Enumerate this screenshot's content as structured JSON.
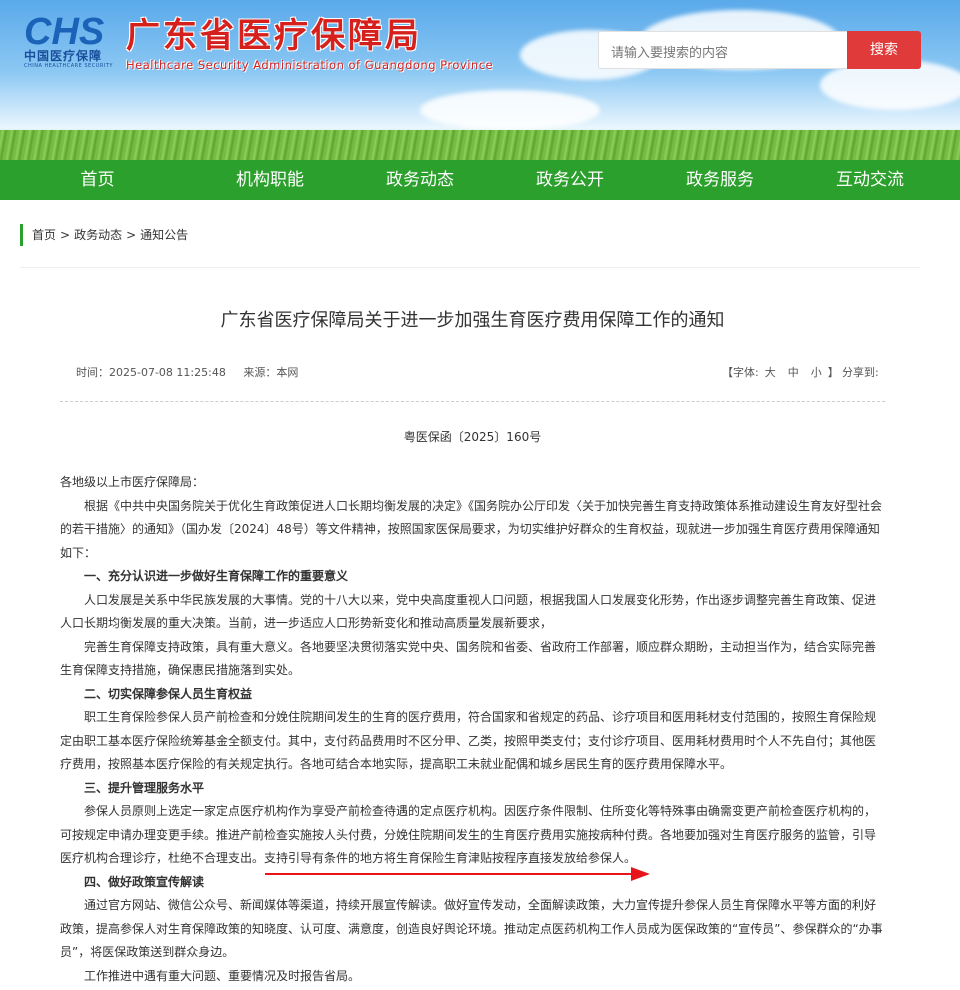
{
  "header": {
    "logo_mark": "CHS",
    "logo_cn": "中国医疗保障",
    "logo_en": "CHINA HEALTHCARE SECURITY",
    "title": "广东省医疗保障局",
    "subtitle": "Healthcare Security Administration of Guangdong Province",
    "search_placeholder": "请输入要搜索的内容",
    "search_button": "搜索"
  },
  "nav": {
    "items": [
      {
        "label": "首页"
      },
      {
        "label": "机构职能"
      },
      {
        "label": "政务动态"
      },
      {
        "label": "政务公开"
      },
      {
        "label": "政务服务"
      },
      {
        "label": "互动交流"
      }
    ]
  },
  "breadcrumb": {
    "items": [
      "首页",
      "政务动态",
      "通知公告"
    ],
    "separator": ">"
  },
  "article": {
    "title": "广东省医疗保障局关于进一步加强生育医疗费用保障工作的通知",
    "time": "时间：2025-07-08 11:25:48",
    "source": "来源：本网",
    "font_label_open": "【字体:",
    "font_big": "大",
    "font_mid": "中",
    "font_small": "小",
    "font_label_close": "】",
    "share": "分享到:",
    "doc_no": "粤医保函〔2025〕160号",
    "paragraphs": [
      "各地级以上市医疗保障局：",
      "根据《中共中央国务院关于优化生育政策促进人口长期均衡发展的决定》《国务院办公厅印发〈关于加快完善生育支持政策体系推动建设生育友好型社会的若干措施〉的通知》（国办发〔2024〕48号）等文件精神，按照国家医保局要求，为切实维护好群众的生育权益，现就进一步加强生育医疗费用保障通知如下：",
      "一、充分认识进一步做好生育保障工作的重要意义",
      "人口发展是关系中华民族发展的大事情。党的十八大以来，党中央高度重视人口问题，根据我国人口发展变化形势，作出逐步调整完善生育政策、促进人口长期均衡发展的重大决策。当前，进一步适应人口形势新变化和推动高质量发展新要求，",
      "完善生育保障支持政策，具有重大意义。各地要坚决贯彻落实党中央、国务院和省委、省政府工作部署，顺应群众期盼，主动担当作为，结合实际完善生育保障支持措施，确保惠民措施落到实处。",
      "二、切实保障参保人员生育权益",
      "职工生育保险参保人员产前检查和分娩住院期间发生的生育的医疗费用，符合国家和省规定的药品、诊疗项目和医用耗材支付范围的，按照生育保险规定由职工基本医疗保险统筹基金全额支付。其中，支付药品费用时不区分甲、乙类，按照甲类支付；支付诊疗项目、医用耗材费用时个人不先自付；其他医疗费用，按照基本医疗保险的有关规定执行。各地可结合本地实际，提高职工未就业配偶和城乡居民生育的医疗费用保障水平。",
      "三、提升管理服务水平",
      "参保人员原则上选定一家定点医疗机构作为享受产前检查待遇的定点医疗机构。因医疗条件限制、住所变化等特殊事由确需变更产前检查医疗机构的，可按规定申请办理变更手续。推进产前检查实施按人头付费，分娩住院期间发生的生育医疗费用实施按病种付费。各地要加强对生育医疗服务的监管，引导医疗机构合理诊疗，杜绝不合理支出。支持引导有条件的地方将生育保险生育津贴按程序直接发放给参保人。",
      "四、做好政策宣传解读",
      "通过官方网站、微信公众号、新闻媒体等渠道，持续开展宣传解读。做好宣传发动，全面解读政策，大力宣传提升参保人员生育保障水平等方面的利好政策，提高参保人对生育保障政策的知晓度、认可度、满意度，创造良好舆论环境。推动定点医药机构工作人员成为医保政策的“宣传员”、参保群众的“办事员”，将医保政策送到群众身边。",
      "工作推进中遇有重大问题、重要情况及时报告省局。"
    ]
  },
  "colors": {
    "nav_green": "#2ca02c",
    "title_red": "#d6201c",
    "search_red": "#e03a3a",
    "annotation_arrow": "#e8141c"
  }
}
